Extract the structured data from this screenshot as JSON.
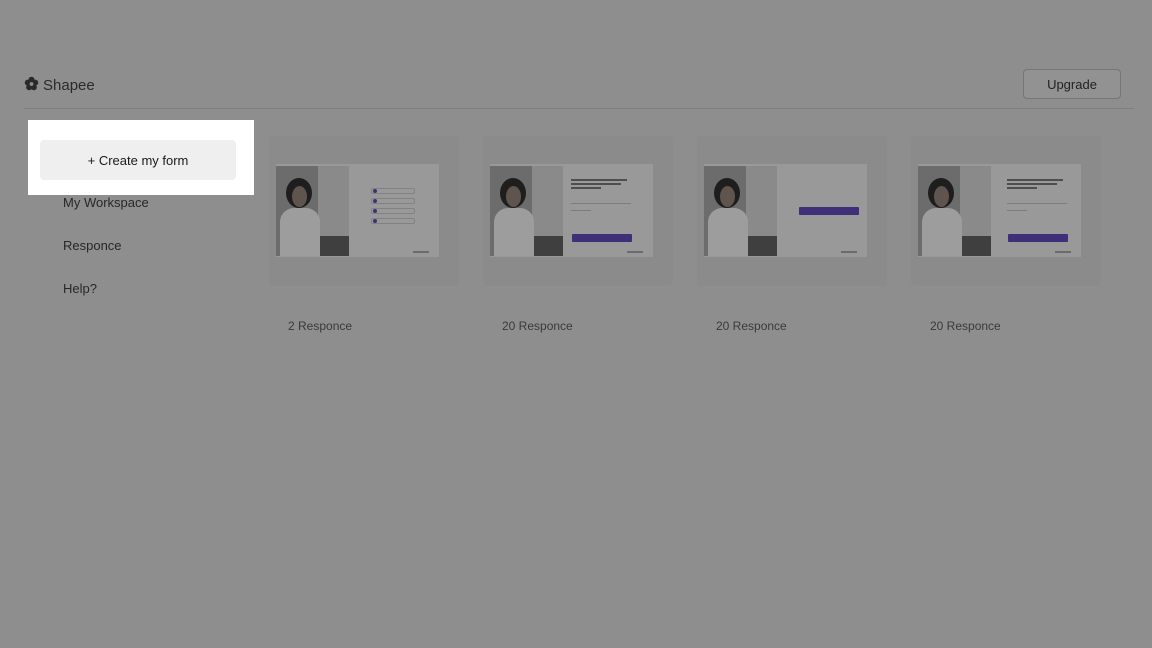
{
  "app": {
    "name": "Shapee",
    "logo_icon": "flower-icon",
    "upgrade_label": "Upgrade"
  },
  "sidebar": {
    "create_label": "+ Create my form",
    "items": [
      {
        "label": "My Workspace"
      },
      {
        "label": "Responce"
      },
      {
        "label": "Help?"
      }
    ]
  },
  "forms": [
    {
      "responses": "2 Responce",
      "thumbnail": "options-form"
    },
    {
      "responses": "20 Responce",
      "thumbnail": "text-input-form"
    },
    {
      "responses": "20 Responce",
      "thumbnail": "button-form"
    },
    {
      "responses": "20 Responce",
      "thumbnail": "text-input-form"
    }
  ],
  "colors": {
    "overlay": "#8e8e8e",
    "highlight": "#ffffff",
    "accent": "#3f2f78"
  }
}
